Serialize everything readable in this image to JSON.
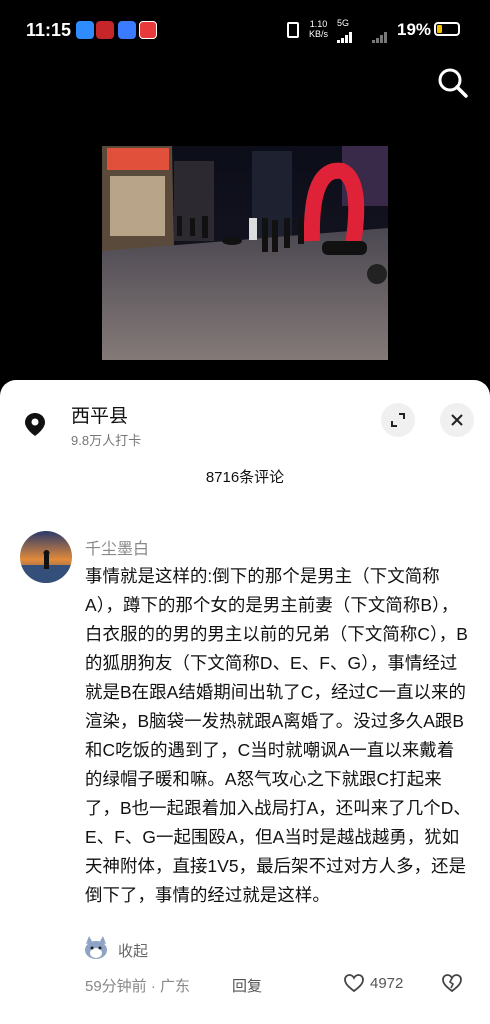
{
  "status_bar": {
    "time": "11:15",
    "net_speed_value": "1.10",
    "net_speed_unit": "KB/s",
    "network": "5G",
    "battery": "19%"
  },
  "location": {
    "name": "西平县",
    "checkins": "9.8万人打卡"
  },
  "comments_count": "8716条评论",
  "comment": {
    "author": "千尘墨白",
    "text": "事情就是这样的:倒下的那个是男主（下文简称A），蹲下的那个女的是男主前妻（下文简称B），白衣服的的男的男主以前的兄弟（下文简称C），B的狐朋狗友（下文简称D、E、F、G），事情经过就是B在跟A结婚期间出轨了C，经过C一直以来的渲染，B脑袋一发热就跟A离婚了。没过多久A跟B和C吃饭的遇到了，C当时就嘲讽A一直以来戴着的绿帽子暖和嘛。A怒气攻心之下就跟C打起来了，B也一起跟着加入战局打A，还叫来了几个D、E、F、G一起围殴A，但A当时是越战越勇，犹如天神附体，直接1V5，最后架不过对方人多，还是倒下了，事情的经过就是这样。",
    "collapse_label": "收起",
    "meta": "59分钟前 · 广东",
    "reply_label": "回复",
    "likes": "4972"
  },
  "icons": {
    "search": "search-icon",
    "location": "location-pin-icon",
    "expand": "expand-icon",
    "close": "close-icon",
    "like": "heart-icon",
    "dislike": "broken-heart-icon"
  }
}
